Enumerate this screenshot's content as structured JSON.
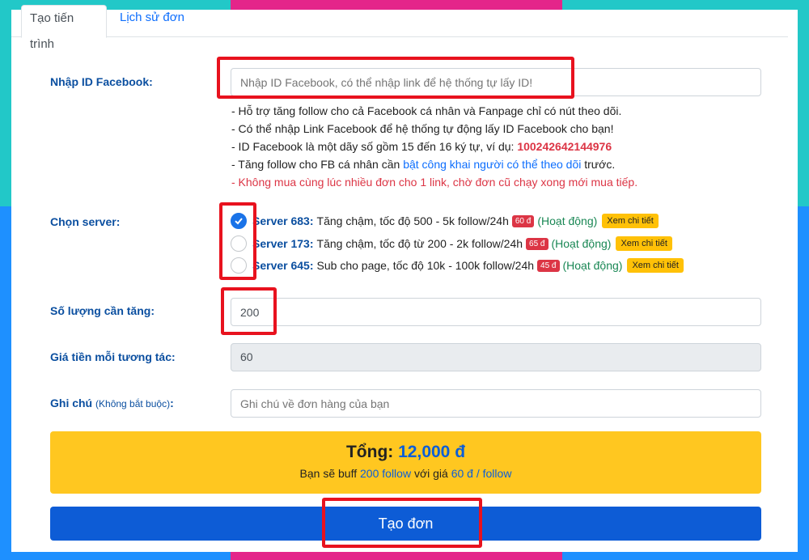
{
  "tabs": [
    {
      "label": "Tạo tiến trình"
    },
    {
      "label": "Lịch sử đơn"
    }
  ],
  "form": {
    "facebook_id": {
      "label": "Nhập ID Facebook:",
      "placeholder": "Nhập ID Facebook, có thể nhập link để hệ thống tự lấy ID!"
    },
    "notes": {
      "line1": "- Hỗ trợ tăng follow cho cả Facebook cá nhân và Fanpage chỉ có nút theo dõi.",
      "line2": "- Có thể nhập Link Facebook để hệ thống tự động lấy ID Facebook cho bạn!",
      "line3_prefix": "- ID Facebook là một dãy số gồm 15 đến 16 ký tự, ví dụ: ",
      "line3_example": "100242642144976",
      "line4_prefix": "- Tăng follow cho FB cá nhân cần ",
      "line4_link": "bật công khai người có thể theo dõi",
      "line4_suffix": " trước.",
      "line5": "- Không mua cùng lúc nhiều đơn cho 1 link, chờ đơn cũ chạy xong mới mua tiếp."
    },
    "server": {
      "label": "Chọn server:",
      "options": [
        {
          "name": "Server 683:",
          "desc": "Tăng chậm, tốc độ 500 - 5k follow/24h",
          "price": "60 đ",
          "status": "(Hoạt động)",
          "detail": "Xem chi tiết",
          "checked": true
        },
        {
          "name": "Server 173:",
          "desc": "Tăng chậm, tốc độ từ 200 - 2k follow/24h",
          "price": "65 đ",
          "status": "(Hoạt động)",
          "detail": "Xem chi tiết",
          "checked": false
        },
        {
          "name": "Server 645:",
          "desc": "Sub cho page, tốc độ 10k - 100k follow/24h",
          "price": "45 đ",
          "status": "(Hoạt động)",
          "detail": "Xem chi tiết",
          "checked": false
        }
      ]
    },
    "quantity": {
      "label": "Số lượng cần tăng:",
      "value": "200"
    },
    "unit_price": {
      "label": "Giá tiền mỗi tương tác:",
      "value": "60"
    },
    "note": {
      "label": "Ghi chú",
      "label_small": "(Không bắt buộc)",
      "label_colon": ":",
      "placeholder": "Ghi chú về đơn hàng của bạn"
    }
  },
  "total": {
    "label": "Tổng:",
    "amount": "12,000 đ",
    "sub_prefix": "Bạn sẽ buff ",
    "sub_qty": "200 follow",
    "sub_mid": " với giá ",
    "sub_price": "60 đ / follow"
  },
  "submit_label": "Tạo đơn",
  "colors": {
    "accent": "#0d5cd6",
    "highlight": "#e8121e",
    "total_bg": "#ffc720"
  }
}
